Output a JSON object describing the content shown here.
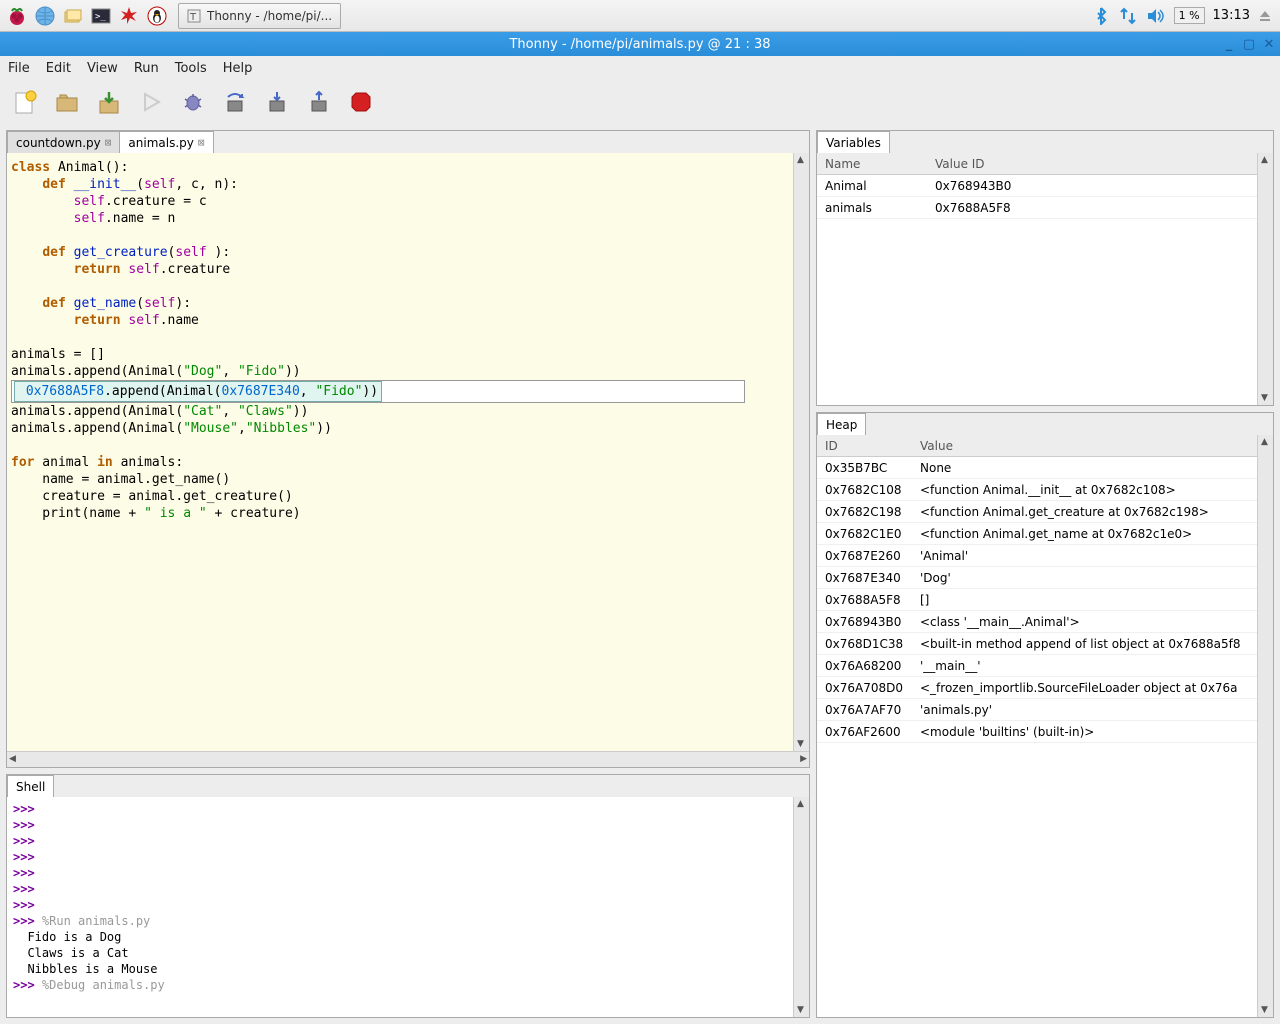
{
  "taskbar": {
    "app_title": "Thonny  -  /home/pi/...",
    "cpu": "1 %",
    "clock": "13:13"
  },
  "titlebar": {
    "text": "Thonny  -  /home/pi/animals.py  @  21 : 38"
  },
  "menubar": [
    "File",
    "Edit",
    "View",
    "Run",
    "Tools",
    "Help"
  ],
  "tabs": {
    "inactive": "countdown.py",
    "active": "animals.py"
  },
  "shell": {
    "tab": "Shell",
    "lines": [
      {
        "prompt": ">>>",
        "text": ""
      },
      {
        "prompt": ">>>",
        "text": ""
      },
      {
        "prompt": ">>>",
        "text": ""
      },
      {
        "prompt": ">>>",
        "text": ""
      },
      {
        "prompt": ">>>",
        "text": ""
      },
      {
        "prompt": ">>>",
        "text": ""
      },
      {
        "prompt": ">>>",
        "text": ""
      },
      {
        "prompt": ">>>",
        "text": " %Run animals.py",
        "faded": true
      },
      {
        "plain": "  Fido is a Dog"
      },
      {
        "plain": "  Claws is a Cat"
      },
      {
        "plain": "  Nibbles is a Mouse"
      },
      {
        "prompt": ">>>",
        "text": " %Debug animals.py",
        "faded": true
      }
    ]
  },
  "variables": {
    "tab": "Variables",
    "head_name": "Name",
    "head_val": "Value ID",
    "rows": [
      {
        "name": "Animal",
        "val": "0x768943B0"
      },
      {
        "name": "animals",
        "val": "0x7688A5F8"
      }
    ]
  },
  "heap": {
    "tab": "Heap",
    "head_id": "ID",
    "head_val": "Value",
    "rows": [
      {
        "id": "0x35B7BC",
        "val": "None"
      },
      {
        "id": "0x7682C108",
        "val": "<function Animal.__init__ at 0x7682c108>"
      },
      {
        "id": "0x7682C198",
        "val": "<function Animal.get_creature at 0x7682c198>"
      },
      {
        "id": "0x7682C1E0",
        "val": "<function Animal.get_name at 0x7682c1e0>"
      },
      {
        "id": "0x7687E260",
        "val": "'Animal'"
      },
      {
        "id": "0x7687E340",
        "val": "'Dog'"
      },
      {
        "id": "0x7688A5F8",
        "val": "[]"
      },
      {
        "id": "0x768943B0",
        "val": "<class '__main__.Animal'>"
      },
      {
        "id": "0x768D1C38",
        "val": "<built-in method append of list object at 0x7688a5f8"
      },
      {
        "id": "0x76A68200",
        "val": "'__main__'"
      },
      {
        "id": "0x76A708D0",
        "val": "<_frozen_importlib.SourceFileLoader object at 0x76a"
      },
      {
        "id": "0x76A7AF70",
        "val": "'animals.py'"
      },
      {
        "id": "0x76AF2600",
        "val": "<module 'builtins' (built-in)>"
      }
    ]
  },
  "debug": {
    "addr1": "0x7688A5F8",
    "addr2": "0x7687E340",
    "fido": "\"Fido\""
  },
  "code": {
    "s_dog": "\"Dog\"",
    "s_fido": "\"Fido\"",
    "s_cat": "\"Cat\"",
    "s_claws": "\"Claws\"",
    "s_mouse": "\"Mouse\"",
    "s_nibbles": "\"Nibbles\"",
    "s_isa": "\" is a \""
  }
}
